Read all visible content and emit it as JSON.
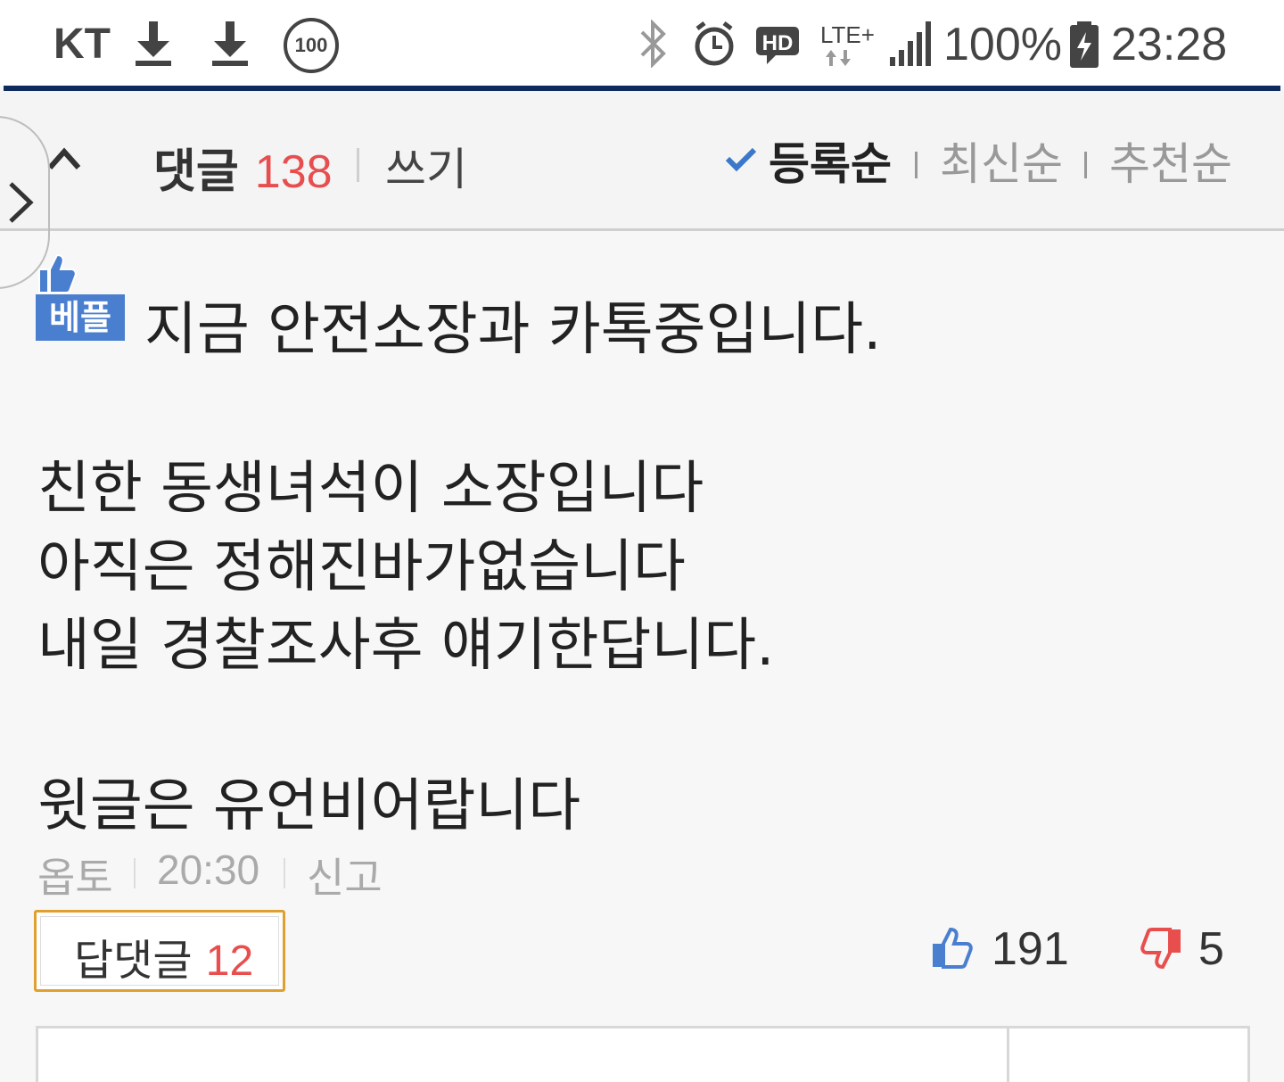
{
  "status_bar": {
    "carrier": "KT",
    "battery_level_badge": "100",
    "network": "LTE+",
    "battery": "100%",
    "time": "23:28",
    "icons": [
      "download-icon",
      "download-icon",
      "bluetooth-icon",
      "alarm-icon",
      "hd-icon",
      "lte-icon",
      "signal-icon",
      "battery-charging-icon"
    ],
    "accent_color": "#0f2a5c"
  },
  "comments_header": {
    "title": "댓글",
    "count": "138",
    "write_label": "쓰기",
    "sort_options": [
      "등록순",
      "최신순",
      "추천순"
    ],
    "active_sort": "등록순"
  },
  "comment": {
    "best_badge": "베플",
    "lines": [
      "지금 안전소장과 카톡중입니다.",
      "친한 동생녀석이 소장입니다",
      "아직은 정해진바가없습니다",
      "내일 경찰조사후 얘기한답니다.",
      "윗글은 유언비어랍니다"
    ],
    "author": "옵토",
    "time": "20:30",
    "report_label": "신고",
    "reply_label": "답댓글",
    "reply_count": "12",
    "likes": "191",
    "dislikes": "5",
    "colors": {
      "count_red": "#e84e4e",
      "badge_blue": "#4a7fd0",
      "reply_border": "#e0a030"
    }
  }
}
